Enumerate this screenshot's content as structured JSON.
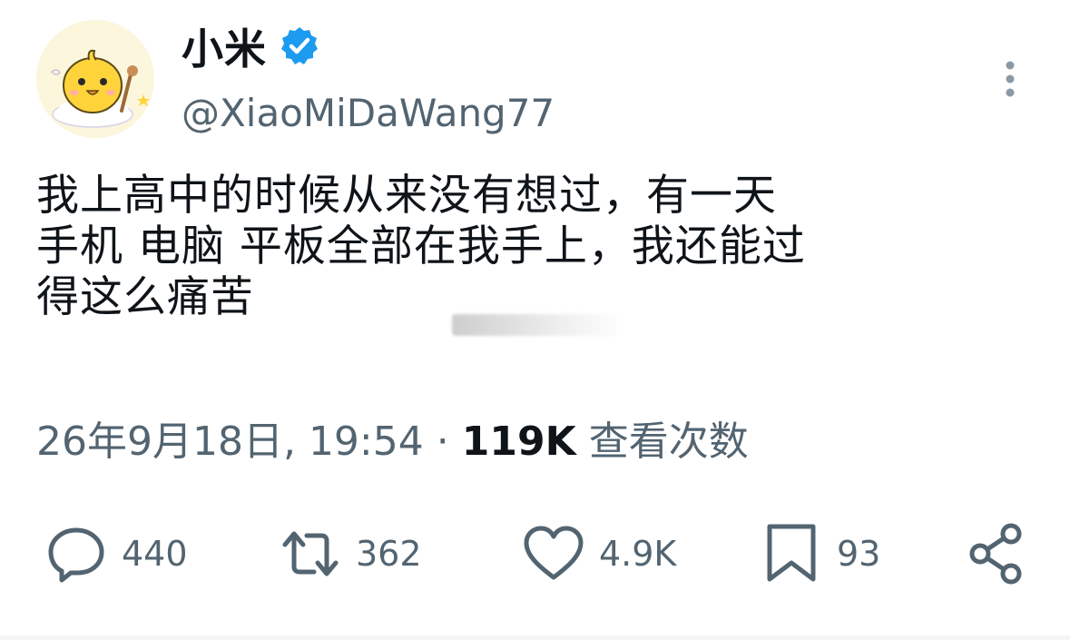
{
  "author": {
    "display_name": "小米",
    "handle": "@XiaoMiDaWang77",
    "verified": true,
    "avatar_icon": "chick-avatar",
    "verified_color": "#1d9bf0"
  },
  "tweet": {
    "text": "我上高中的时候从来没有想过，有一天\n手机 电脑 平板全部在我手上，我还能过\n得这么痛苦"
  },
  "meta": {
    "timestamp": "26年9月18日, 19:54",
    "separator": "·",
    "views_count": "119K",
    "views_label": "查看次数"
  },
  "actions": {
    "reply": {
      "icon": "reply-icon",
      "count": "440"
    },
    "retweet": {
      "icon": "retweet-icon",
      "count": "362"
    },
    "like": {
      "icon": "heart-icon",
      "count": "4.9K"
    },
    "bookmark": {
      "icon": "bookmark-icon",
      "count": "93"
    },
    "share": {
      "icon": "share-icon"
    }
  },
  "more_icon": "more-vertical-icon",
  "colors": {
    "text_primary": "#0f1419",
    "text_secondary": "#536471",
    "accent": "#1d9bf0"
  }
}
